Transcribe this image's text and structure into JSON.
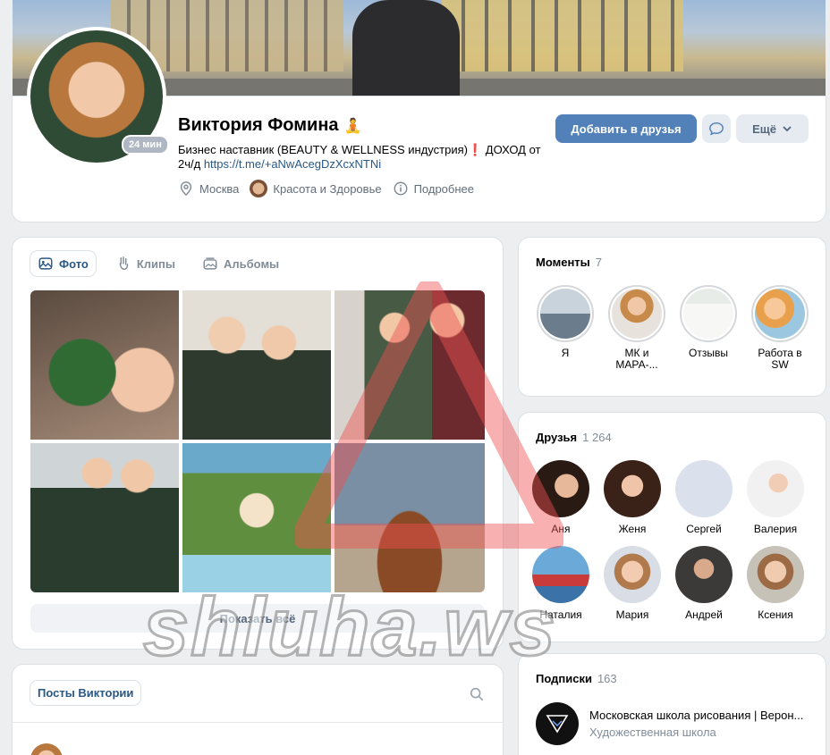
{
  "profile": {
    "name": "Виктория Фомина",
    "name_emoji": "🧘",
    "online_badge": "24 мин",
    "status_text": "Бизнес наставник (BEAUTY & WELLNESS индустрия)",
    "status_mark": "❗",
    "status_text2": " ДОХОД от 2ч/д ",
    "status_link": "https://t.me/+aNwAcegDzXcxNTNi",
    "city": "Москва",
    "group": "Красота и Здоровье",
    "more_info": "Подробнее",
    "add_friend_label": "Добавить в друзья",
    "more_label": "Ещё"
  },
  "photos": {
    "tabs": [
      {
        "label": "Фото",
        "icon": "photo-icon"
      },
      {
        "label": "Клипы",
        "icon": "clip-icon"
      },
      {
        "label": "Альбомы",
        "icon": "album-icon"
      }
    ],
    "show_all_label": "Показать всё"
  },
  "posts": {
    "chip_label": "Посты Виктории"
  },
  "moments": {
    "title": "Моменты",
    "count": "7",
    "items": [
      {
        "label": "Я"
      },
      {
        "label": "МК и МАРА-..."
      },
      {
        "label": "Отзывы"
      },
      {
        "label": "Работа в SW"
      }
    ]
  },
  "friends": {
    "title": "Друзья",
    "count": "1 264",
    "items": [
      {
        "name": "Аня"
      },
      {
        "name": "Женя"
      },
      {
        "name": "Сергей"
      },
      {
        "name": "Валерия"
      },
      {
        "name": "Наталия"
      },
      {
        "name": "Мария"
      },
      {
        "name": "Андрей"
      },
      {
        "name": "Ксения"
      }
    ]
  },
  "subscriptions": {
    "title": "Подписки",
    "count": "163",
    "items": [
      {
        "name": "Московская школа рисования | Верон...",
        "desc": "Художественная школа"
      }
    ]
  },
  "watermark": "shluha.ws",
  "colors": {
    "accent": "#5181b8",
    "link": "#2a5885",
    "secondary": "#818c99",
    "background": "#edeef0"
  }
}
